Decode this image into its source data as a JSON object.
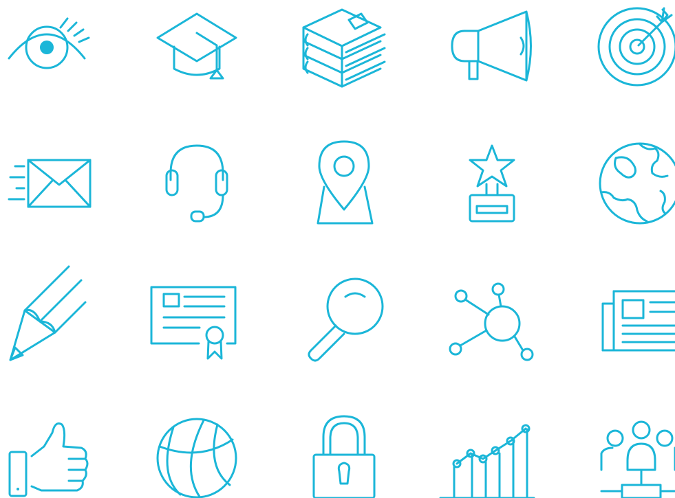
{
  "accent_color": "#1BB6D8",
  "icons": [
    {
      "name": "eye-icon"
    },
    {
      "name": "graduation-cap-icon"
    },
    {
      "name": "books-stack-icon"
    },
    {
      "name": "megaphone-icon"
    },
    {
      "name": "target-icon"
    },
    {
      "name": "mail-icon"
    },
    {
      "name": "headset-icon"
    },
    {
      "name": "map-pin-icon"
    },
    {
      "name": "trophy-icon"
    },
    {
      "name": "globe-icon"
    },
    {
      "name": "pencil-icon"
    },
    {
      "name": "certificate-icon"
    },
    {
      "name": "magnifier-icon"
    },
    {
      "name": "network-icon"
    },
    {
      "name": "newspaper-icon"
    },
    {
      "name": "thumbs-up-icon"
    },
    {
      "name": "basketball-icon"
    },
    {
      "name": "padlock-icon"
    },
    {
      "name": "growth-chart-icon"
    },
    {
      "name": "team-icon"
    }
  ]
}
